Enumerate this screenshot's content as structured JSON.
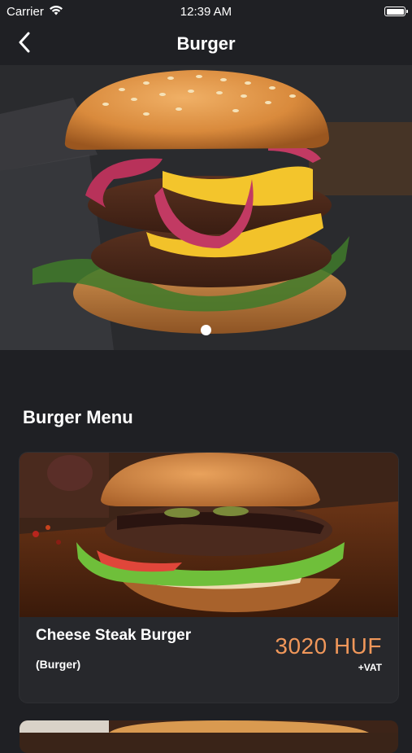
{
  "status_bar": {
    "carrier": "Carrier",
    "time": "12:39 AM"
  },
  "nav": {
    "title": "Burger",
    "back_icon": "chevron-left-icon"
  },
  "hero": {
    "image": "burger-hero-photo",
    "carousel_pages": 1,
    "active_page": 1
  },
  "section": {
    "title": "Burger Menu"
  },
  "menu_items": [
    {
      "name": "Cheese Steak Burger",
      "category": "(Burger)",
      "price": "3020 HUF",
      "vat": "+VAT",
      "image": "cheese-steak-burger-photo"
    }
  ],
  "colors": {
    "background": "#1f2024",
    "card": "#27282c",
    "price_accent": "#f0975a"
  }
}
